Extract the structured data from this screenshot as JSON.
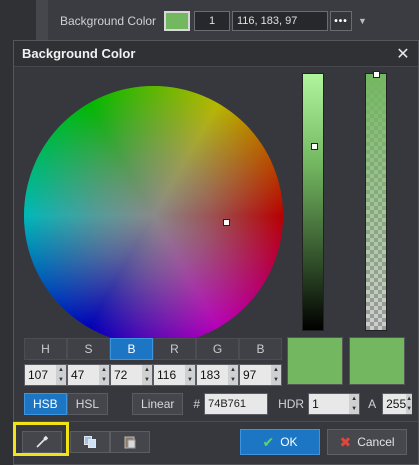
{
  "background_property": {
    "label": "Background Color",
    "swatch_color": "#74b761",
    "alpha_value": "1",
    "rgb_value": "116, 183, 97",
    "more_label": "•••"
  },
  "dialog": {
    "title": "Background Color",
    "close_icon": "✕"
  },
  "channels": {
    "tabs": [
      {
        "label": "H",
        "value": "107"
      },
      {
        "label": "S",
        "value": "47"
      },
      {
        "label": "B",
        "value": "72"
      },
      {
        "label": "R",
        "value": "116"
      },
      {
        "label": "G",
        "value": "183"
      },
      {
        "label": "B",
        "value": "97"
      }
    ],
    "active_index": 2
  },
  "preview": {
    "new_color": "#74b761",
    "old_color": "#74b761"
  },
  "modes": {
    "hsb": "HSB",
    "hsl": "HSL",
    "linear": "Linear",
    "hash": "#",
    "hex": "74B761",
    "hdr_label": "HDR",
    "hdr_value": "1",
    "a_label": "A",
    "a_value": "255"
  },
  "buttons": {
    "ok": "OK",
    "cancel": "Cancel"
  },
  "icons": {
    "picker": "eyedropper-icon",
    "copy": "copy-icon",
    "paste": "paste-icon"
  },
  "colors": {
    "accent": "#1d76c4",
    "highlight": "#f0e31a"
  }
}
